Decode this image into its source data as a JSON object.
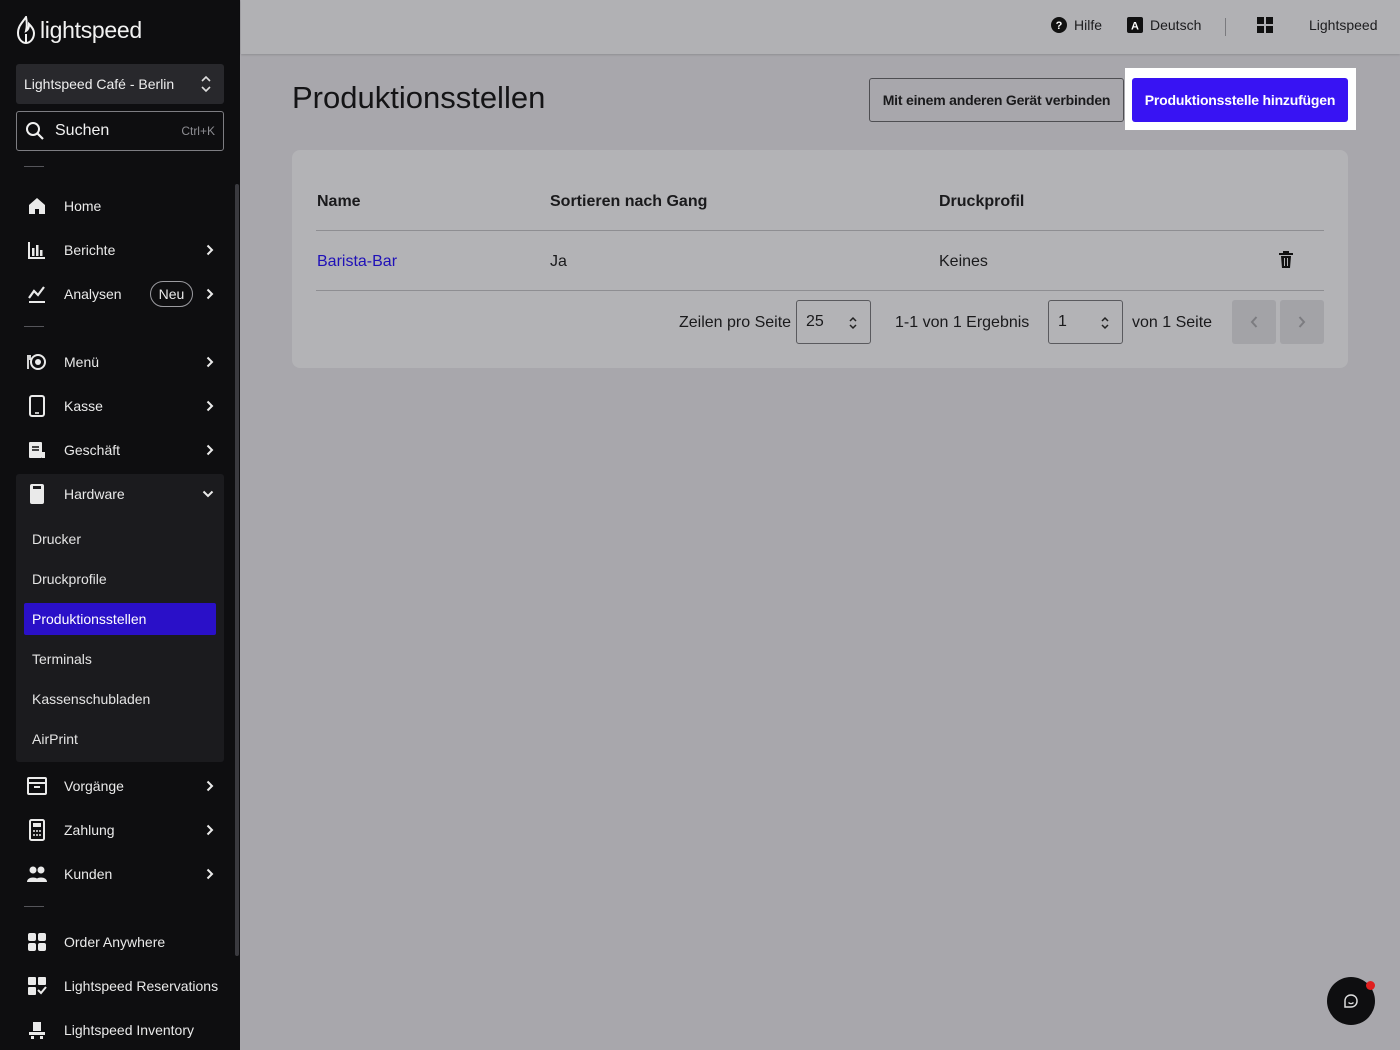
{
  "brand": {
    "name": "lightspeed"
  },
  "location": {
    "label": "Lightspeed Café - Berlin"
  },
  "search": {
    "label": "Suchen",
    "shortcut": "Ctrl+K"
  },
  "nav": {
    "home": "Home",
    "berichte": "Berichte",
    "analysen": "Analysen",
    "analysen_badge": "Neu",
    "menu": "Menü",
    "kasse": "Kasse",
    "geschaeft": "Geschäft",
    "hardware": "Hardware",
    "hardware_items": [
      "Drucker",
      "Druckprofile",
      "Produktionsstellen",
      "Terminals",
      "Kassenschubladen",
      "AirPrint"
    ],
    "vorgaenge": "Vorgänge",
    "zahlung": "Zahlung",
    "kunden": "Kunden",
    "order_anywhere": "Order Anywhere",
    "reservations": "Lightspeed Reservations",
    "inventory": "Lightspeed Inventory"
  },
  "topbar": {
    "help": "Hilfe",
    "language": "Deutsch",
    "account": "Lightspeed"
  },
  "page": {
    "title": "Produktionsstellen",
    "connect_button": "Mit einem anderen Gerät verbinden",
    "add_button": "Produktionsstelle hinzufügen"
  },
  "table": {
    "headers": [
      "Name",
      "Sortieren nach Gang",
      "Druckprofil"
    ],
    "rows": [
      {
        "name": "Barista-Bar",
        "sort_by_course": "Ja",
        "print_profile": "Keines"
      }
    ]
  },
  "pagination": {
    "rows_per_page_label": "Zeilen pro Seite",
    "rows_per_page": "25",
    "results": "1-1 von 1 Ergebnis",
    "page": "1",
    "page_of": "von 1 Seite"
  },
  "colors": {
    "primary": "#3813f3",
    "active_nav": "#2a10c8",
    "link": "#1f10b8",
    "sidebar": "#0e0e10"
  }
}
